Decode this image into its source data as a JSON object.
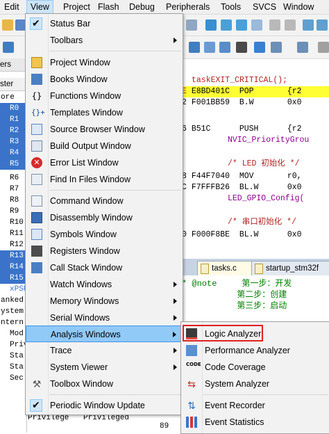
{
  "menubar": {
    "items": [
      "Edit",
      "View",
      "Project",
      "Flash",
      "Debug",
      "Peripherals",
      "Tools",
      "SVCS",
      "Window"
    ]
  },
  "registers": {
    "header1": "ers",
    "header2": "ster",
    "header3": "ore",
    "rows": [
      "R0",
      "R1",
      "R2",
      "R3",
      "R4",
      "R5",
      "R6",
      "R7",
      "R8",
      "R9",
      "R10",
      "R11",
      "R12",
      "R13",
      "R14",
      "R15",
      "xPSR"
    ],
    "below": [
      "anked",
      "ystem",
      "ntern",
      "Mod",
      "Priv",
      "Sta",
      "Sta",
      "Sec"
    ]
  },
  "code": {
    "lines": [
      {
        "addr": "",
        "op": "",
        "arg": "taskEXIT_CRITICAL();"
      },
      {
        "addr": "E",
        "op": "E8BD401C",
        "arg": "POP       {r2"
      },
      {
        "addr": "2",
        "op": "F001BB59",
        "arg": "B.W       0x0"
      },
      {
        "addr": "",
        "op": "",
        "arg": ""
      },
      {
        "addr": "6",
        "op": "B51C",
        "arg": "PUSH      {r2"
      },
      {
        "addr": "",
        "op": "",
        "arg": "NVIC_PriorityGrou"
      },
      {
        "addr": "",
        "op": "",
        "arg": ""
      },
      {
        "addr": "",
        "op": "",
        "arg": "/* LED 初始化 */"
      },
      {
        "addr": "8",
        "op": "F44F7040",
        "arg": "MOV       r0,"
      },
      {
        "addr": "C",
        "op": "F7FFFB26",
        "arg": "BL.W      0x0"
      },
      {
        "addr": "",
        "op": "",
        "arg": "LED_GPIO_Config("
      },
      {
        "addr": "",
        "op": "",
        "arg": ""
      },
      {
        "addr": "",
        "op": "",
        "arg": "/* 串口初始化 */"
      },
      {
        "addr": "0",
        "op": "F000F8BE",
        "arg": "BL.W      0x0"
      }
    ]
  },
  "tabs": [
    "tasks.c",
    "startup_stm32f"
  ],
  "comment": {
    "lines": [
      "* @note     第一步：开发",
      "           第二步：创建",
      "           第三步：启动"
    ]
  },
  "bottom": {
    "col1": "Privilege",
    "col2": "Privileged",
    "line": "89"
  },
  "view_menu": {
    "items": [
      {
        "label": "Status Bar",
        "icon": "check-icon",
        "checked": true,
        "submenu": false
      },
      {
        "label": "Toolbars",
        "icon": "",
        "checked": false,
        "submenu": true
      },
      {
        "label": "Project Window",
        "icon": "project-window-icon",
        "checked": false,
        "submenu": false
      },
      {
        "label": "Books Window",
        "icon": "books-window-icon",
        "checked": false,
        "submenu": false
      },
      {
        "label": "Functions Window",
        "icon": "functions-window-icon",
        "checked": false,
        "submenu": false
      },
      {
        "label": "Templates Window",
        "icon": "templates-window-icon",
        "checked": false,
        "submenu": false
      },
      {
        "label": "Source Browser Window",
        "icon": "source-browser-icon",
        "checked": false,
        "submenu": false
      },
      {
        "label": "Build Output Window",
        "icon": "build-output-icon",
        "checked": false,
        "submenu": false
      },
      {
        "label": "Error List Window",
        "icon": "error-list-icon",
        "checked": false,
        "submenu": false
      },
      {
        "label": "Find In Files Window",
        "icon": "find-in-files-icon",
        "checked": false,
        "submenu": false
      },
      {
        "label": "Command Window",
        "icon": "command-window-icon",
        "checked": false,
        "submenu": false
      },
      {
        "label": "Disassembly Window",
        "icon": "disassembly-window-icon",
        "checked": false,
        "submenu": false
      },
      {
        "label": "Symbols Window",
        "icon": "symbols-window-icon",
        "checked": false,
        "submenu": false
      },
      {
        "label": "Registers Window",
        "icon": "registers-window-icon",
        "checked": false,
        "submenu": false
      },
      {
        "label": "Call Stack Window",
        "icon": "call-stack-icon",
        "checked": false,
        "submenu": false
      },
      {
        "label": "Watch Windows",
        "icon": "",
        "checked": false,
        "submenu": true
      },
      {
        "label": "Memory Windows",
        "icon": "",
        "checked": false,
        "submenu": true
      },
      {
        "label": "Serial Windows",
        "icon": "",
        "checked": false,
        "submenu": true
      },
      {
        "label": "Analysis Windows",
        "icon": "",
        "checked": false,
        "submenu": true
      },
      {
        "label": "Trace",
        "icon": "",
        "checked": false,
        "submenu": true
      },
      {
        "label": "System Viewer",
        "icon": "",
        "checked": false,
        "submenu": true
      },
      {
        "label": "Toolbox Window",
        "icon": "toolbox-icon",
        "checked": false,
        "submenu": false
      },
      {
        "label": "Periodic Window Update",
        "icon": "check-icon",
        "checked": true,
        "submenu": false
      }
    ]
  },
  "analysis_submenu": {
    "items": [
      {
        "label": "Logic Analyzer",
        "icon": "logic-analyzer-icon"
      },
      {
        "label": "Performance Analyzer",
        "icon": "performance-analyzer-icon"
      },
      {
        "label": "Code Coverage",
        "icon": "code-coverage-icon"
      },
      {
        "label": "System Analyzer",
        "icon": "system-analyzer-icon"
      },
      {
        "label": "Event Recorder",
        "icon": "event-recorder-icon"
      },
      {
        "label": "Event Statistics",
        "icon": "event-statistics-icon"
      }
    ]
  },
  "colors": {
    "highlight": "#91c9f7",
    "selection": "#3a73c9",
    "callout": "#e02020"
  }
}
